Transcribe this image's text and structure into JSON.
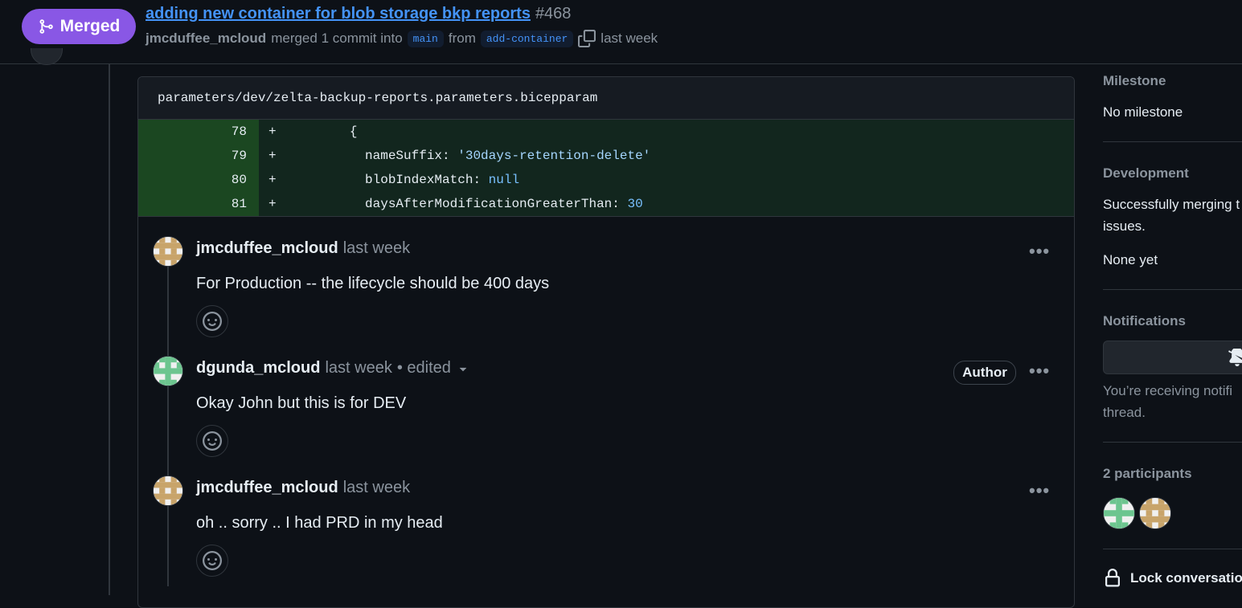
{
  "header": {
    "badge_label": "Merged",
    "title": "adding new container for blob storage bkp reports",
    "number": "#468",
    "author": "jmcduffee_mcloud",
    "merged_text": "merged 1 commit into",
    "base_branch": "main",
    "from_text": "from",
    "head_branch": "add-container",
    "time": "last week"
  },
  "file": {
    "path": "parameters/dev/zelta-backup-reports.parameters.bicepparam",
    "lines": [
      {
        "num": "78",
        "sign": "+",
        "indent": "        ",
        "key": "{",
        "sep": "",
        "value": "",
        "value_type": ""
      },
      {
        "num": "79",
        "sign": "+",
        "indent": "          ",
        "key": "nameSuffix",
        "sep": ": ",
        "value": "'30days-retention-delete'",
        "value_type": "string"
      },
      {
        "num": "80",
        "sign": "+",
        "indent": "          ",
        "key": "blobIndexMatch",
        "sep": ": ",
        "value": "null",
        "value_type": "keyword"
      },
      {
        "num": "81",
        "sign": "+",
        "indent": "          ",
        "key": "daysAfterModificationGreaterThan",
        "sep": ": ",
        "value": "30",
        "value_type": "keyword"
      }
    ]
  },
  "comments": [
    {
      "author": "jmcduffee_mcloud",
      "time": "last week",
      "edited": "",
      "body": "For Production -- the lifecycle should be 400 days",
      "badge": "",
      "avatar_color": "#c8a46a"
    },
    {
      "author": "dgunda_mcloud",
      "time": "last week",
      "edited": "• edited",
      "body": "Okay John but this is for DEV",
      "badge": "Author",
      "avatar_color": "#6cc58f"
    },
    {
      "author": "jmcduffee_mcloud",
      "time": "last week",
      "edited": "",
      "body": "oh .. sorry .. I had PRD in my head",
      "badge": "",
      "avatar_color": "#c8a46a"
    }
  ],
  "sidebar": {
    "milestone_title": "Milestone",
    "milestone_value": "No milestone",
    "development_title": "Development",
    "development_text_1": "Successfully merging t",
    "development_text_2": "issues.",
    "development_value": "None yet",
    "notifications_title": "Notifications",
    "notifications_text_1": "You’re receiving notifi",
    "notifications_text_2": "thread.",
    "participants_title": "2 participants",
    "lock_label": "Lock conversation"
  },
  "colors": {
    "merged": "#8957e5",
    "link": "#4493f8",
    "diff_add_bg": "#12261e",
    "diff_add_num_bg": "#1b4721"
  }
}
